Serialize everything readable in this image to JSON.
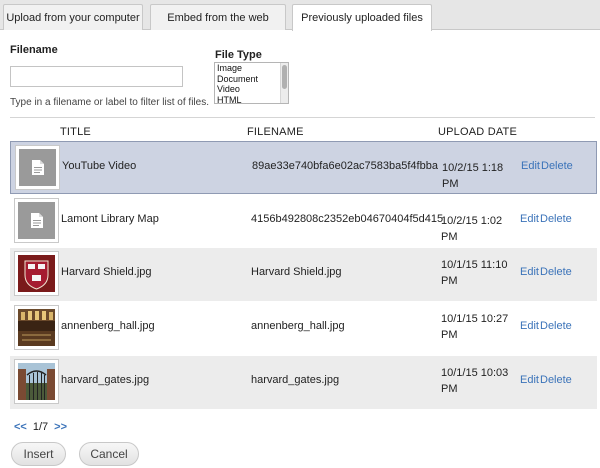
{
  "tabs": {
    "upload": "Upload from your computer",
    "embed": "Embed from the web",
    "previous": "Previously uploaded files"
  },
  "filters": {
    "filename_label": "Filename",
    "filename_value": "",
    "filename_help": "Type in a filename or label to filter list of files.",
    "filetype_label": "File Type",
    "filetype_options": [
      "Image",
      "Document",
      "Video",
      "HTML"
    ]
  },
  "table": {
    "headers": {
      "title": "TITLE",
      "filename": "FILENAME",
      "upload_date": "UPLOAD DATE"
    },
    "rows": [
      {
        "title": "YouTube Video",
        "filename": "89ae33e740bfa6e02ac7583ba5f4fbba",
        "date": "10/2/15 1:18 PM",
        "edit": "Edit",
        "delete": "Delete",
        "thumb": "document-icon"
      },
      {
        "title": "Lamont Library Map",
        "filename": "4156b492808c2352eb04670404f5d415",
        "date": "10/2/15 1:02 PM",
        "edit": "Edit",
        "delete": "Delete",
        "thumb": "document-icon"
      },
      {
        "title": "Harvard Shield.jpg",
        "filename": "Harvard Shield.jpg",
        "date": "10/1/15 11:10 PM",
        "edit": "Edit",
        "delete": "Delete",
        "thumb": "harvard-shield-thumbnail"
      },
      {
        "title": "annenberg_hall.jpg",
        "filename": "annenberg_hall.jpg",
        "date": "10/1/15 10:27 PM",
        "edit": "Edit",
        "delete": "Delete",
        "thumb": "annenberg-hall-thumbnail"
      },
      {
        "title": "harvard_gates.jpg",
        "filename": "harvard_gates.jpg",
        "date": "10/1/15 10:03 PM",
        "edit": "Edit",
        "delete": "Delete",
        "thumb": "harvard-gates-thumbnail"
      }
    ]
  },
  "pager": {
    "prev": "<<",
    "page": "1/7",
    "next": ">>"
  },
  "buttons": {
    "insert": "Insert",
    "cancel": "Cancel"
  },
  "colors": {
    "link": "#3b73b9",
    "selected_row": "#cdd3e2",
    "shaded_row": "#ececec"
  }
}
